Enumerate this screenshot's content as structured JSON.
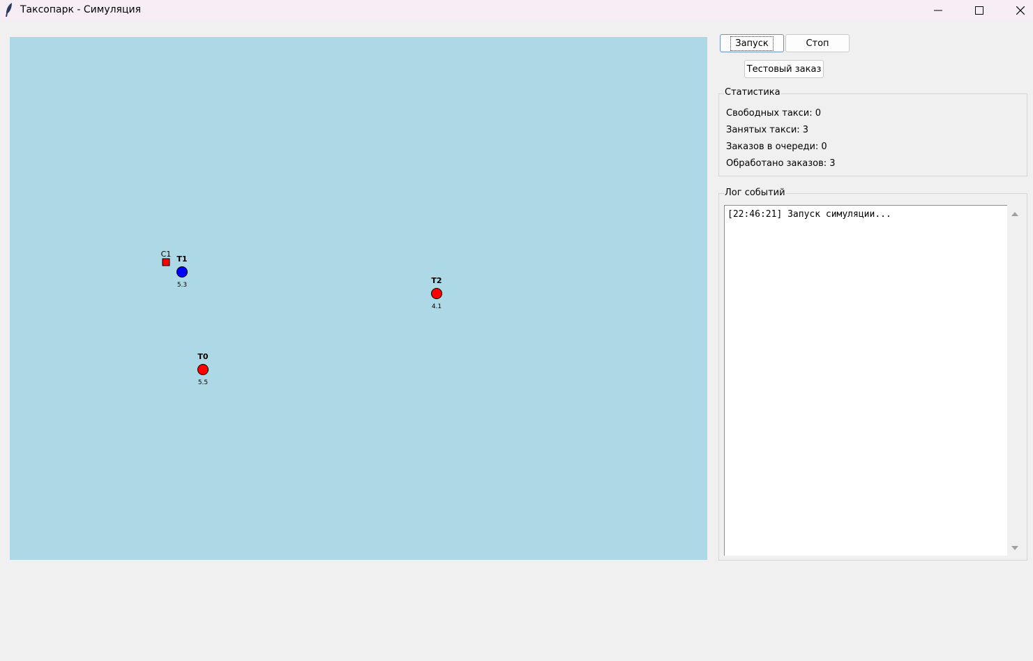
{
  "window": {
    "title": "Таксопарк - Симуляция",
    "icon": "feather-icon",
    "controls": [
      "minimize-icon",
      "maximize-icon",
      "close-icon"
    ]
  },
  "controls": {
    "start_label": "Запуск",
    "stop_label": "Стоп",
    "test_order_label": "Тестовый заказ"
  },
  "stats": {
    "title": "Статистика",
    "free_taxis": "Свободных такси: 0",
    "busy_taxis": "Занятых такси: 3",
    "orders_in_queue": "Заказов в очереди: 0",
    "orders_processed": "Обработано заказов: 3"
  },
  "log": {
    "title": "Лог событий",
    "lines": [
      "[22:46:21] Запуск симуляции..."
    ]
  },
  "map": {
    "background": "#add8e6",
    "taxis": [
      {
        "id": "T1",
        "value": "5.3",
        "color": "#0000ff"
      },
      {
        "id": "T2",
        "value": "4.1",
        "color": "#ff0000"
      },
      {
        "id": "T0",
        "value": "5.5",
        "color": "#ff0000"
      }
    ],
    "clients": [
      {
        "id": "C1",
        "color": "#ff0000"
      }
    ]
  }
}
